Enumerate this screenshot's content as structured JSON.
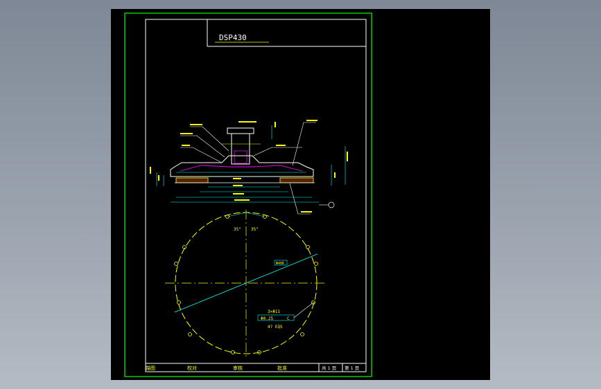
{
  "title_block": {
    "drawing_no": "DSP430"
  },
  "view": {
    "angle_left": "35°",
    "angle_right": "35°",
    "hole_callout": "3×Φ11",
    "tolerance": "Φ0.25",
    "datum": "C",
    "hole_count_note": "4? EQS",
    "diameter_tag": "Φ406"
  },
  "footer": {
    "cell_1": "描图",
    "cell_2": "校对",
    "cell_3": "审核",
    "cell_4": "批准",
    "sheets": "共 1 页",
    "sheet_no": "第 1 页"
  },
  "colors": {
    "frame_green": "#00ff00",
    "line_white": "#ffffff",
    "dim_cyan": "#00ffff",
    "circle_yellow": "#ffff00",
    "part_magenta": "#ff00ff"
  }
}
